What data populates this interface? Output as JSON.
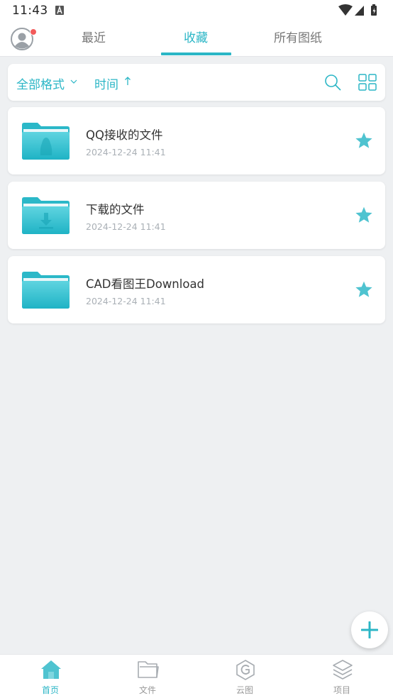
{
  "status_bar": {
    "time": "11:43"
  },
  "tabs": {
    "items": [
      {
        "label": "最近"
      },
      {
        "label": "收藏"
      },
      {
        "label": "所有图纸"
      }
    ],
    "active_index": 1
  },
  "filter": {
    "format_label": "全部格式",
    "sort_label": "时间"
  },
  "files": [
    {
      "name": "QQ接收的文件",
      "date": "2024-12-24 11:41",
      "icon": "folder-qq-icon",
      "starred": true
    },
    {
      "name": "下载的文件",
      "date": "2024-12-24 11:41",
      "icon": "folder-download-icon",
      "starred": true
    },
    {
      "name": "CAD看图王Download",
      "date": "2024-12-24 11:41",
      "icon": "folder-icon",
      "starred": true
    }
  ],
  "bottom_nav": {
    "items": [
      {
        "label": "首页",
        "icon": "home-icon"
      },
      {
        "label": "文件",
        "icon": "folder-outline-icon"
      },
      {
        "label": "云图",
        "icon": "cloud-drawing-icon"
      },
      {
        "label": "项目",
        "icon": "layers-icon"
      }
    ],
    "active_index": 0
  },
  "colors": {
    "accent": "#2bb6c6",
    "star": "#4fc3d0",
    "badge": "#f25a5a",
    "background": "#eef0f2"
  }
}
